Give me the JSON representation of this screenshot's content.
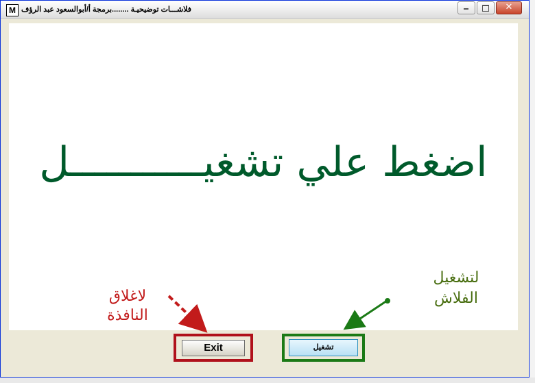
{
  "window": {
    "title": "فلاشـــات توضيحيـة ........برمجة أ/أبوالسعود عبد الرؤف",
    "app_icon_letter": "M"
  },
  "controls": {
    "minimize_icon": "minimize-icon",
    "maximize_icon": "maximize-icon",
    "close_glyph": "✕"
  },
  "flash": {
    "main_text": "اضغط علي تشغيـــــــــــل",
    "color": "#005a2b"
  },
  "buttons": {
    "exit_label": "Exit",
    "run_label": "تشغيل"
  },
  "annotations": {
    "close_line1": "لاغلاق",
    "close_line2": "النافذة",
    "run_line1": "لتشغيل",
    "run_line2": "الفلاش",
    "close_color": "#c21b1b",
    "run_color": "#4a6f12"
  }
}
